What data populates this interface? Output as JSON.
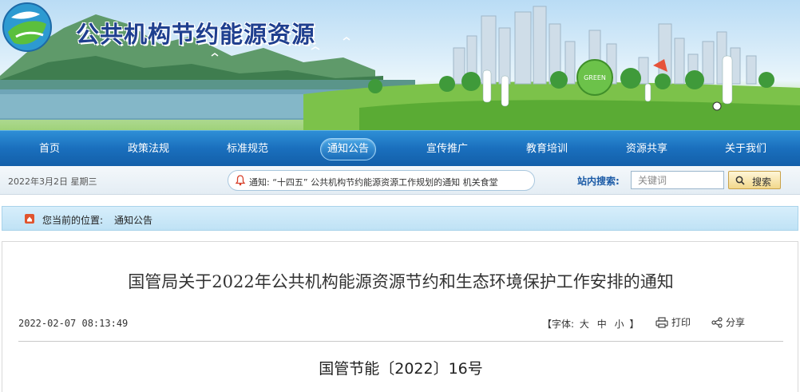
{
  "site": {
    "title": "公共机构节约能源资源",
    "logo_icon": "globe-leaf-logo-icon",
    "green_sign": "GREEN"
  },
  "nav": {
    "items": [
      {
        "label": "首页",
        "active": false
      },
      {
        "label": "政策法规",
        "active": false
      },
      {
        "label": "标准规范",
        "active": false
      },
      {
        "label": "通知公告",
        "active": true
      },
      {
        "label": "宣传推广",
        "active": false
      },
      {
        "label": "教育培训",
        "active": false
      },
      {
        "label": "资源共享",
        "active": false
      },
      {
        "label": "关于我们",
        "active": false
      }
    ]
  },
  "infobar": {
    "date": "2022年3月2日  星期三",
    "notice": "通知: “十四五” 公共机构节约能源资源工作规划的通知     机关食堂",
    "search_label": "站内搜索:",
    "search_placeholder": "关键词",
    "search_button": "搜索"
  },
  "breadcrumb": {
    "label": "您当前的位置:",
    "current": "通知公告"
  },
  "article": {
    "title": "国管局关于2022年公共机构能源资源节约和生态环境保护工作安排的通知",
    "datetime": "2022-02-07 08:13:49",
    "font_size_label": "【字体:",
    "font_sizes": [
      "大",
      "中",
      "小"
    ],
    "font_size_close": "】",
    "print_label": "打印",
    "share_label": "分享",
    "doc_number": "国管节能〔2022〕16号"
  },
  "colors": {
    "nav": "#1a6fbd",
    "title": "#1f3f8f",
    "accent": "#1a5aa6"
  }
}
